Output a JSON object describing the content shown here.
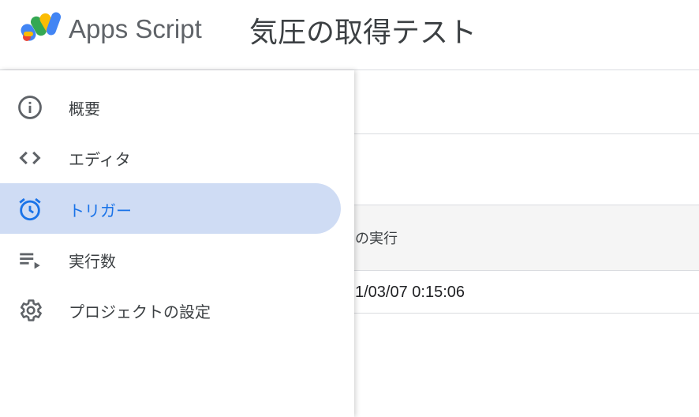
{
  "header": {
    "product_name": "Apps Script",
    "project_title": "気圧の取得テスト"
  },
  "nav": {
    "items": [
      {
        "label": "概要",
        "icon": "info-icon",
        "active": false
      },
      {
        "label": "エディタ",
        "icon": "code-icon",
        "active": false
      },
      {
        "label": "トリガー",
        "icon": "alarm-clock-icon",
        "active": true
      },
      {
        "label": "実行数",
        "icon": "playlist-play-icon",
        "active": false
      },
      {
        "label": "プロジェクトの設定",
        "icon": "gear-icon",
        "active": false
      }
    ]
  },
  "main": {
    "table_header_partial": "の実行",
    "table_cell_partial": "1/03/07 0:15:06"
  },
  "colors": {
    "active_bg": "#cfdcf4",
    "active_fg": "#1a73e8",
    "icon_gray": "#5f6368"
  }
}
